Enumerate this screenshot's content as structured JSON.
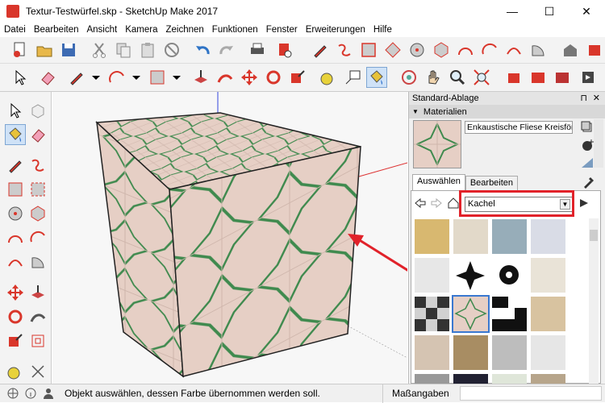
{
  "window": {
    "title": "Textur-Testwürfel.skp - SketchUp Make 2017",
    "minimize": "—",
    "maximize": "☐",
    "close": "✕"
  },
  "menu": [
    "Datei",
    "Bearbeiten",
    "Ansicht",
    "Kamera",
    "Zeichnen",
    "Funktionen",
    "Fenster",
    "Erweiterungen",
    "Hilfe"
  ],
  "tray": {
    "title": "Standard-Ablage",
    "pin": "⊓",
    "close": "✕",
    "section": "Materialien",
    "material_name": "Enkaustische Fliese Kreisförmig",
    "tabs": [
      "Auswählen",
      "Bearbeiten"
    ],
    "collection": "Kachel"
  },
  "status": {
    "hint": "Objekt auswählen, dessen Farbe übernommen werden soll.",
    "measurements_label": "Maßangaben"
  },
  "colors": {
    "accent": "#e1222a",
    "tile_bg": "#e6cfc5",
    "tile_lines": "#3f8a4e",
    "selection": "#3a78d0"
  }
}
